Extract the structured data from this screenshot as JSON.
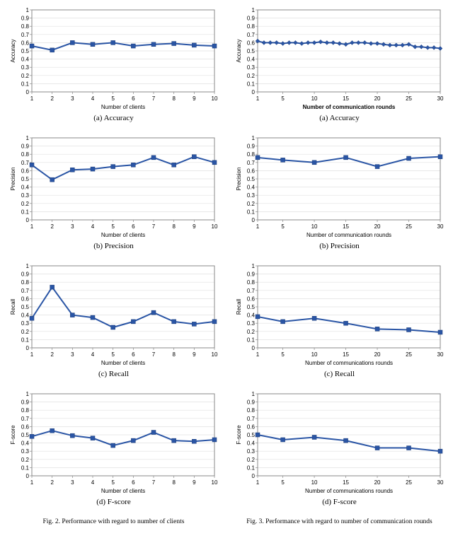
{
  "chart_data": [
    {
      "id": "left_accuracy",
      "type": "line",
      "xlabel": "Number of clients",
      "ylabel": "Accuracy",
      "caption": "(a) Accuracy",
      "xlabel_bold": false,
      "x": [
        1,
        2,
        3,
        4,
        5,
        6,
        7,
        8,
        9,
        10
      ],
      "y": [
        0.56,
        0.51,
        0.6,
        0.58,
        0.6,
        0.56,
        0.58,
        0.59,
        0.57,
        0.56
      ],
      "xlim": [
        1,
        10
      ],
      "ylim": [
        0,
        1
      ],
      "xticks": [
        1,
        2,
        3,
        4,
        5,
        6,
        7,
        8,
        9,
        10
      ],
      "yticks": [
        0,
        0.1,
        0.2,
        0.3,
        0.4,
        0.5,
        0.6,
        0.7,
        0.8,
        0.9,
        1
      ],
      "marker": "square"
    },
    {
      "id": "right_accuracy",
      "type": "line",
      "xlabel": "Number of communication rounds",
      "ylabel": "Accuracy",
      "caption": "(a) Accuracy",
      "xlabel_bold": true,
      "x": [
        1,
        2,
        3,
        4,
        5,
        6,
        7,
        8,
        9,
        10,
        11,
        12,
        13,
        14,
        15,
        16,
        17,
        18,
        19,
        20,
        21,
        22,
        23,
        24,
        25,
        26,
        27,
        28,
        29,
        30
      ],
      "y": [
        0.62,
        0.6,
        0.6,
        0.6,
        0.59,
        0.6,
        0.6,
        0.59,
        0.6,
        0.6,
        0.61,
        0.6,
        0.6,
        0.59,
        0.58,
        0.6,
        0.6,
        0.6,
        0.59,
        0.59,
        0.58,
        0.57,
        0.57,
        0.57,
        0.58,
        0.55,
        0.55,
        0.54,
        0.54,
        0.53
      ],
      "xlim": [
        1,
        30
      ],
      "ylim": [
        0,
        1
      ],
      "xticks": [
        1,
        5,
        10,
        15,
        20,
        25,
        30
      ],
      "yticks": [
        0,
        0.1,
        0.2,
        0.3,
        0.4,
        0.5,
        0.6,
        0.7,
        0.8,
        0.9,
        1
      ],
      "marker": "diamond"
    },
    {
      "id": "left_precision",
      "type": "line",
      "xlabel": "Number of clients",
      "ylabel": "Precision",
      "caption": "(b) Precision",
      "xlabel_bold": false,
      "x": [
        1,
        2,
        3,
        4,
        5,
        6,
        7,
        8,
        9,
        10
      ],
      "y": [
        0.67,
        0.49,
        0.61,
        0.62,
        0.65,
        0.67,
        0.76,
        0.67,
        0.77,
        0.7
      ],
      "xlim": [
        1,
        10
      ],
      "ylim": [
        0,
        1
      ],
      "xticks": [
        1,
        2,
        3,
        4,
        5,
        6,
        7,
        8,
        9,
        10
      ],
      "yticks": [
        0,
        0.1,
        0.2,
        0.3,
        0.4,
        0.5,
        0.6,
        0.7,
        0.8,
        0.9,
        1
      ],
      "marker": "square"
    },
    {
      "id": "right_precision",
      "type": "line",
      "xlabel": "Number of communication rounds",
      "ylabel": "Precision",
      "caption": "(b) Precision",
      "xlabel_bold": false,
      "x": [
        1,
        5,
        10,
        15,
        20,
        25,
        30
      ],
      "y": [
        0.76,
        0.73,
        0.7,
        0.76,
        0.65,
        0.75,
        0.77
      ],
      "xlim": [
        1,
        30
      ],
      "ylim": [
        0,
        1
      ],
      "xticks": [
        1,
        5,
        10,
        15,
        20,
        25,
        30
      ],
      "yticks": [
        0,
        0.1,
        0.2,
        0.3,
        0.4,
        0.5,
        0.6,
        0.7,
        0.8,
        0.9,
        1
      ],
      "marker": "square"
    },
    {
      "id": "left_recall",
      "type": "line",
      "xlabel": "Number of clients",
      "ylabel": "Recall",
      "caption": "(c) Recall",
      "xlabel_bold": false,
      "x": [
        1,
        2,
        3,
        4,
        5,
        6,
        7,
        8,
        9,
        10
      ],
      "y": [
        0.36,
        0.74,
        0.4,
        0.37,
        0.25,
        0.32,
        0.43,
        0.32,
        0.29,
        0.32
      ],
      "xlim": [
        1,
        10
      ],
      "ylim": [
        0,
        1
      ],
      "xticks": [
        1,
        2,
        3,
        4,
        5,
        6,
        7,
        8,
        9,
        10
      ],
      "yticks": [
        0,
        0.1,
        0.2,
        0.3,
        0.4,
        0.5,
        0.6,
        0.7,
        0.8,
        0.9,
        1
      ],
      "marker": "square"
    },
    {
      "id": "right_recall",
      "type": "line",
      "xlabel": "Number of communications rounds",
      "ylabel": "Recall",
      "caption": "(c) Recall",
      "xlabel_bold": false,
      "x": [
        1,
        5,
        10,
        15,
        20,
        25,
        30
      ],
      "y": [
        0.38,
        0.32,
        0.36,
        0.3,
        0.23,
        0.22,
        0.19
      ],
      "xlim": [
        1,
        30
      ],
      "ylim": [
        0,
        1
      ],
      "xticks": [
        1,
        5,
        10,
        15,
        20,
        25,
        30
      ],
      "yticks": [
        0,
        0.1,
        0.2,
        0.3,
        0.4,
        0.5,
        0.6,
        0.7,
        0.8,
        0.9,
        1
      ],
      "marker": "square"
    },
    {
      "id": "left_fscore",
      "type": "line",
      "xlabel": "Number of clients",
      "ylabel": "F-score",
      "caption": "(d) F-score",
      "xlabel_bold": false,
      "x": [
        1,
        2,
        3,
        4,
        5,
        6,
        7,
        8,
        9,
        10
      ],
      "y": [
        0.48,
        0.55,
        0.49,
        0.46,
        0.37,
        0.43,
        0.53,
        0.43,
        0.42,
        0.44
      ],
      "xlim": [
        1,
        10
      ],
      "ylim": [
        0,
        1
      ],
      "xticks": [
        1,
        2,
        3,
        4,
        5,
        6,
        7,
        8,
        9,
        10
      ],
      "yticks": [
        0,
        0.1,
        0.2,
        0.3,
        0.4,
        0.5,
        0.6,
        0.7,
        0.8,
        0.9,
        1
      ],
      "marker": "square"
    },
    {
      "id": "right_fscore",
      "type": "line",
      "xlabel": "Number of communications rounds",
      "ylabel": "F-score",
      "caption": "(d) F-score",
      "xlabel_bold": false,
      "x": [
        1,
        5,
        10,
        15,
        20,
        25,
        30
      ],
      "y": [
        0.5,
        0.44,
        0.47,
        0.43,
        0.34,
        0.34,
        0.3
      ],
      "xlim": [
        1,
        30
      ],
      "ylim": [
        0,
        1
      ],
      "xticks": [
        1,
        5,
        10,
        15,
        20,
        25,
        30
      ],
      "yticks": [
        0,
        0.1,
        0.2,
        0.3,
        0.4,
        0.5,
        0.6,
        0.7,
        0.8,
        0.9,
        1
      ],
      "marker": "square"
    }
  ],
  "figure_captions": {
    "left": "Fig. 2.  Performance with regard to number of clients",
    "right": "Fig. 3.  Performance with regard to number of communication rounds"
  }
}
